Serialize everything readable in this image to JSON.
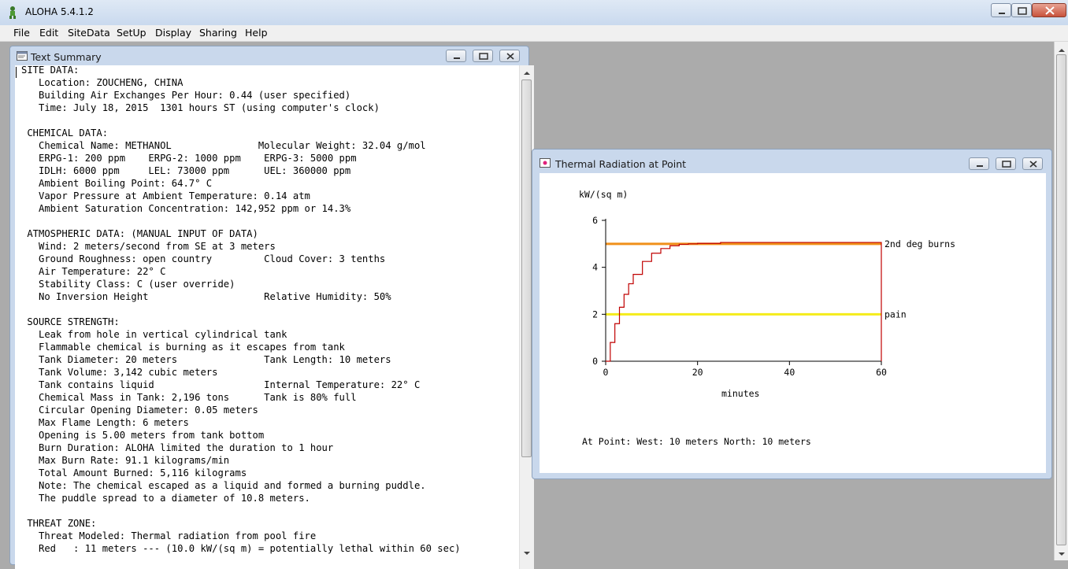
{
  "app": {
    "title": "ALOHA 5.4.1.2"
  },
  "menu": {
    "items": [
      "File",
      "Edit",
      "SiteData",
      "SetUp",
      "Display",
      "Sharing",
      "Help"
    ]
  },
  "text_summary": {
    "title": "Text Summary",
    "lines": [
      "SITE DATA:",
      "   Location: ZOUCHENG, CHINA",
      "   Building Air Exchanges Per Hour: 0.44 (user specified)",
      "   Time: July 18, 2015  1301 hours ST (using computer's clock)",
      "",
      " CHEMICAL DATA:",
      "   Chemical Name: METHANOL               Molecular Weight: 32.04 g/mol",
      "   ERPG-1: 200 ppm    ERPG-2: 1000 ppm    ERPG-3: 5000 ppm",
      "   IDLH: 6000 ppm     LEL: 73000 ppm      UEL: 360000 ppm",
      "   Ambient Boiling Point: 64.7° C",
      "   Vapor Pressure at Ambient Temperature: 0.14 atm",
      "   Ambient Saturation Concentration: 142,952 ppm or 14.3%",
      "",
      " ATMOSPHERIC DATA: (MANUAL INPUT OF DATA)",
      "   Wind: 2 meters/second from SE at 3 meters",
      "   Ground Roughness: open country         Cloud Cover: 3 tenths",
      "   Air Temperature: 22° C",
      "   Stability Class: C (user override)",
      "   No Inversion Height                    Relative Humidity: 50%",
      "",
      " SOURCE STRENGTH:",
      "   Leak from hole in vertical cylindrical tank",
      "   Flammable chemical is burning as it escapes from tank",
      "   Tank Diameter: 20 meters               Tank Length: 10 meters",
      "   Tank Volume: 3,142 cubic meters",
      "   Tank contains liquid                   Internal Temperature: 22° C",
      "   Chemical Mass in Tank: 2,196 tons      Tank is 80% full",
      "   Circular Opening Diameter: 0.05 meters",
      "   Max Flame Length: 6 meters",
      "   Opening is 5.00 meters from tank bottom",
      "   Burn Duration: ALOHA limited the duration to 1 hour",
      "   Max Burn Rate: 91.1 kilograms/min",
      "   Total Amount Burned: 5,116 kilograms",
      "   Note: The chemical escaped as a liquid and formed a burning puddle.",
      "   The puddle spread to a diameter of 10.8 meters.",
      "",
      " THREAT ZONE:",
      "   Threat Modeled: Thermal radiation from pool fire",
      "   Red   : 11 meters --- (10.0 kW/(sq m) = potentially lethal within 60 sec)"
    ]
  },
  "thermal_window": {
    "title": "Thermal Radiation at Point",
    "at_point": "At Point:   West: 10 meters   North: 10 meters"
  },
  "chart_data": {
    "type": "line",
    "ylabel": "kW/(sq m)",
    "xlabel": "minutes",
    "xlim": [
      0,
      60
    ],
    "ylim": [
      0,
      6
    ],
    "x_ticks": [
      "0",
      "20",
      "40",
      "60"
    ],
    "y_ticks": [
      "0",
      "2",
      "4",
      "6"
    ],
    "thresholds": [
      {
        "name": "2nd deg burns",
        "value": 5,
        "color": "#f0901a"
      },
      {
        "name": "pain",
        "value": 2,
        "color": "#f4ec1a"
      }
    ],
    "series": [
      {
        "color": "#c00000",
        "x": [
          0,
          1,
          2,
          3,
          4,
          5,
          6,
          8,
          10,
          12,
          14,
          16,
          18,
          20,
          25,
          30,
          40,
          50,
          60
        ],
        "y": [
          0,
          0.8,
          1.6,
          2.3,
          2.85,
          3.3,
          3.7,
          4.25,
          4.6,
          4.8,
          4.92,
          4.98,
          5.0,
          5.02,
          5.06,
          5.06,
          5.06,
          5.06,
          5.06
        ]
      }
    ]
  }
}
